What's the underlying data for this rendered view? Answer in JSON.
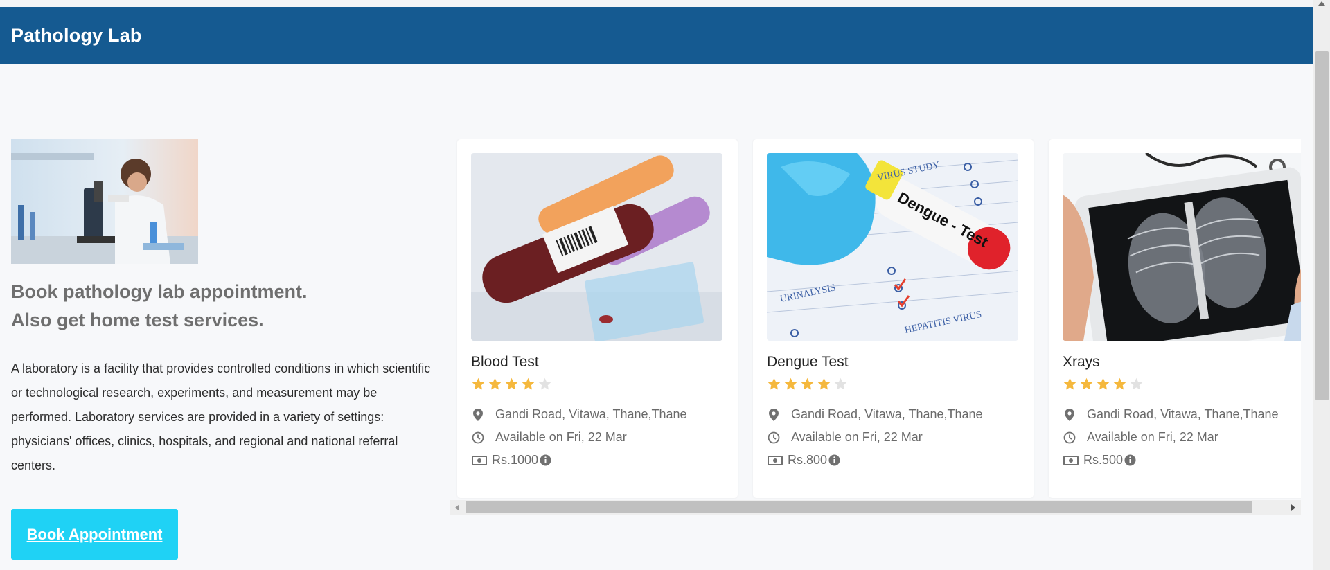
{
  "header": {
    "brand": "Pathology Lab"
  },
  "intro": {
    "headline_line1": "Book pathology lab appointment.",
    "headline_line2": "Also get home test services.",
    "description": "A laboratory is a facility that provides controlled conditions in which scientific or technological research, experiments, and measurement may be performed. Laboratory services are provided in a variety of settings: physicians' offices, clinics, hospitals, and regional and national referral centers.",
    "cta_label": "Book Appointment"
  },
  "colors": {
    "navbar": "#155a91",
    "cta": "#1fd2f5",
    "star": "#f5b83d",
    "star_empty": "#e2e2e2"
  },
  "icons": [
    "map-marker-icon",
    "clock-icon",
    "money-icon",
    "info-circle-icon",
    "star-icon"
  ],
  "tests": [
    {
      "name": "Blood Test",
      "rating": 4,
      "max_rating": 5,
      "address": "Gandi Road, Vitawa, Thane,Thane",
      "availability": "Available on Fri, 22 Mar",
      "price": "Rs.1000"
    },
    {
      "name": "Dengue Test",
      "rating": 4,
      "max_rating": 5,
      "address": "Gandi Road, Vitawa, Thane,Thane",
      "availability": "Available on Fri, 22 Mar",
      "price": "Rs.800",
      "image_label": "Dengue - Test"
    },
    {
      "name": "Xrays",
      "rating": 4,
      "max_rating": 5,
      "address": "Gandi Road, Vitawa, Thane,Thane",
      "availability": "Available on Fri, 22 Mar",
      "price": "Rs.500"
    }
  ]
}
